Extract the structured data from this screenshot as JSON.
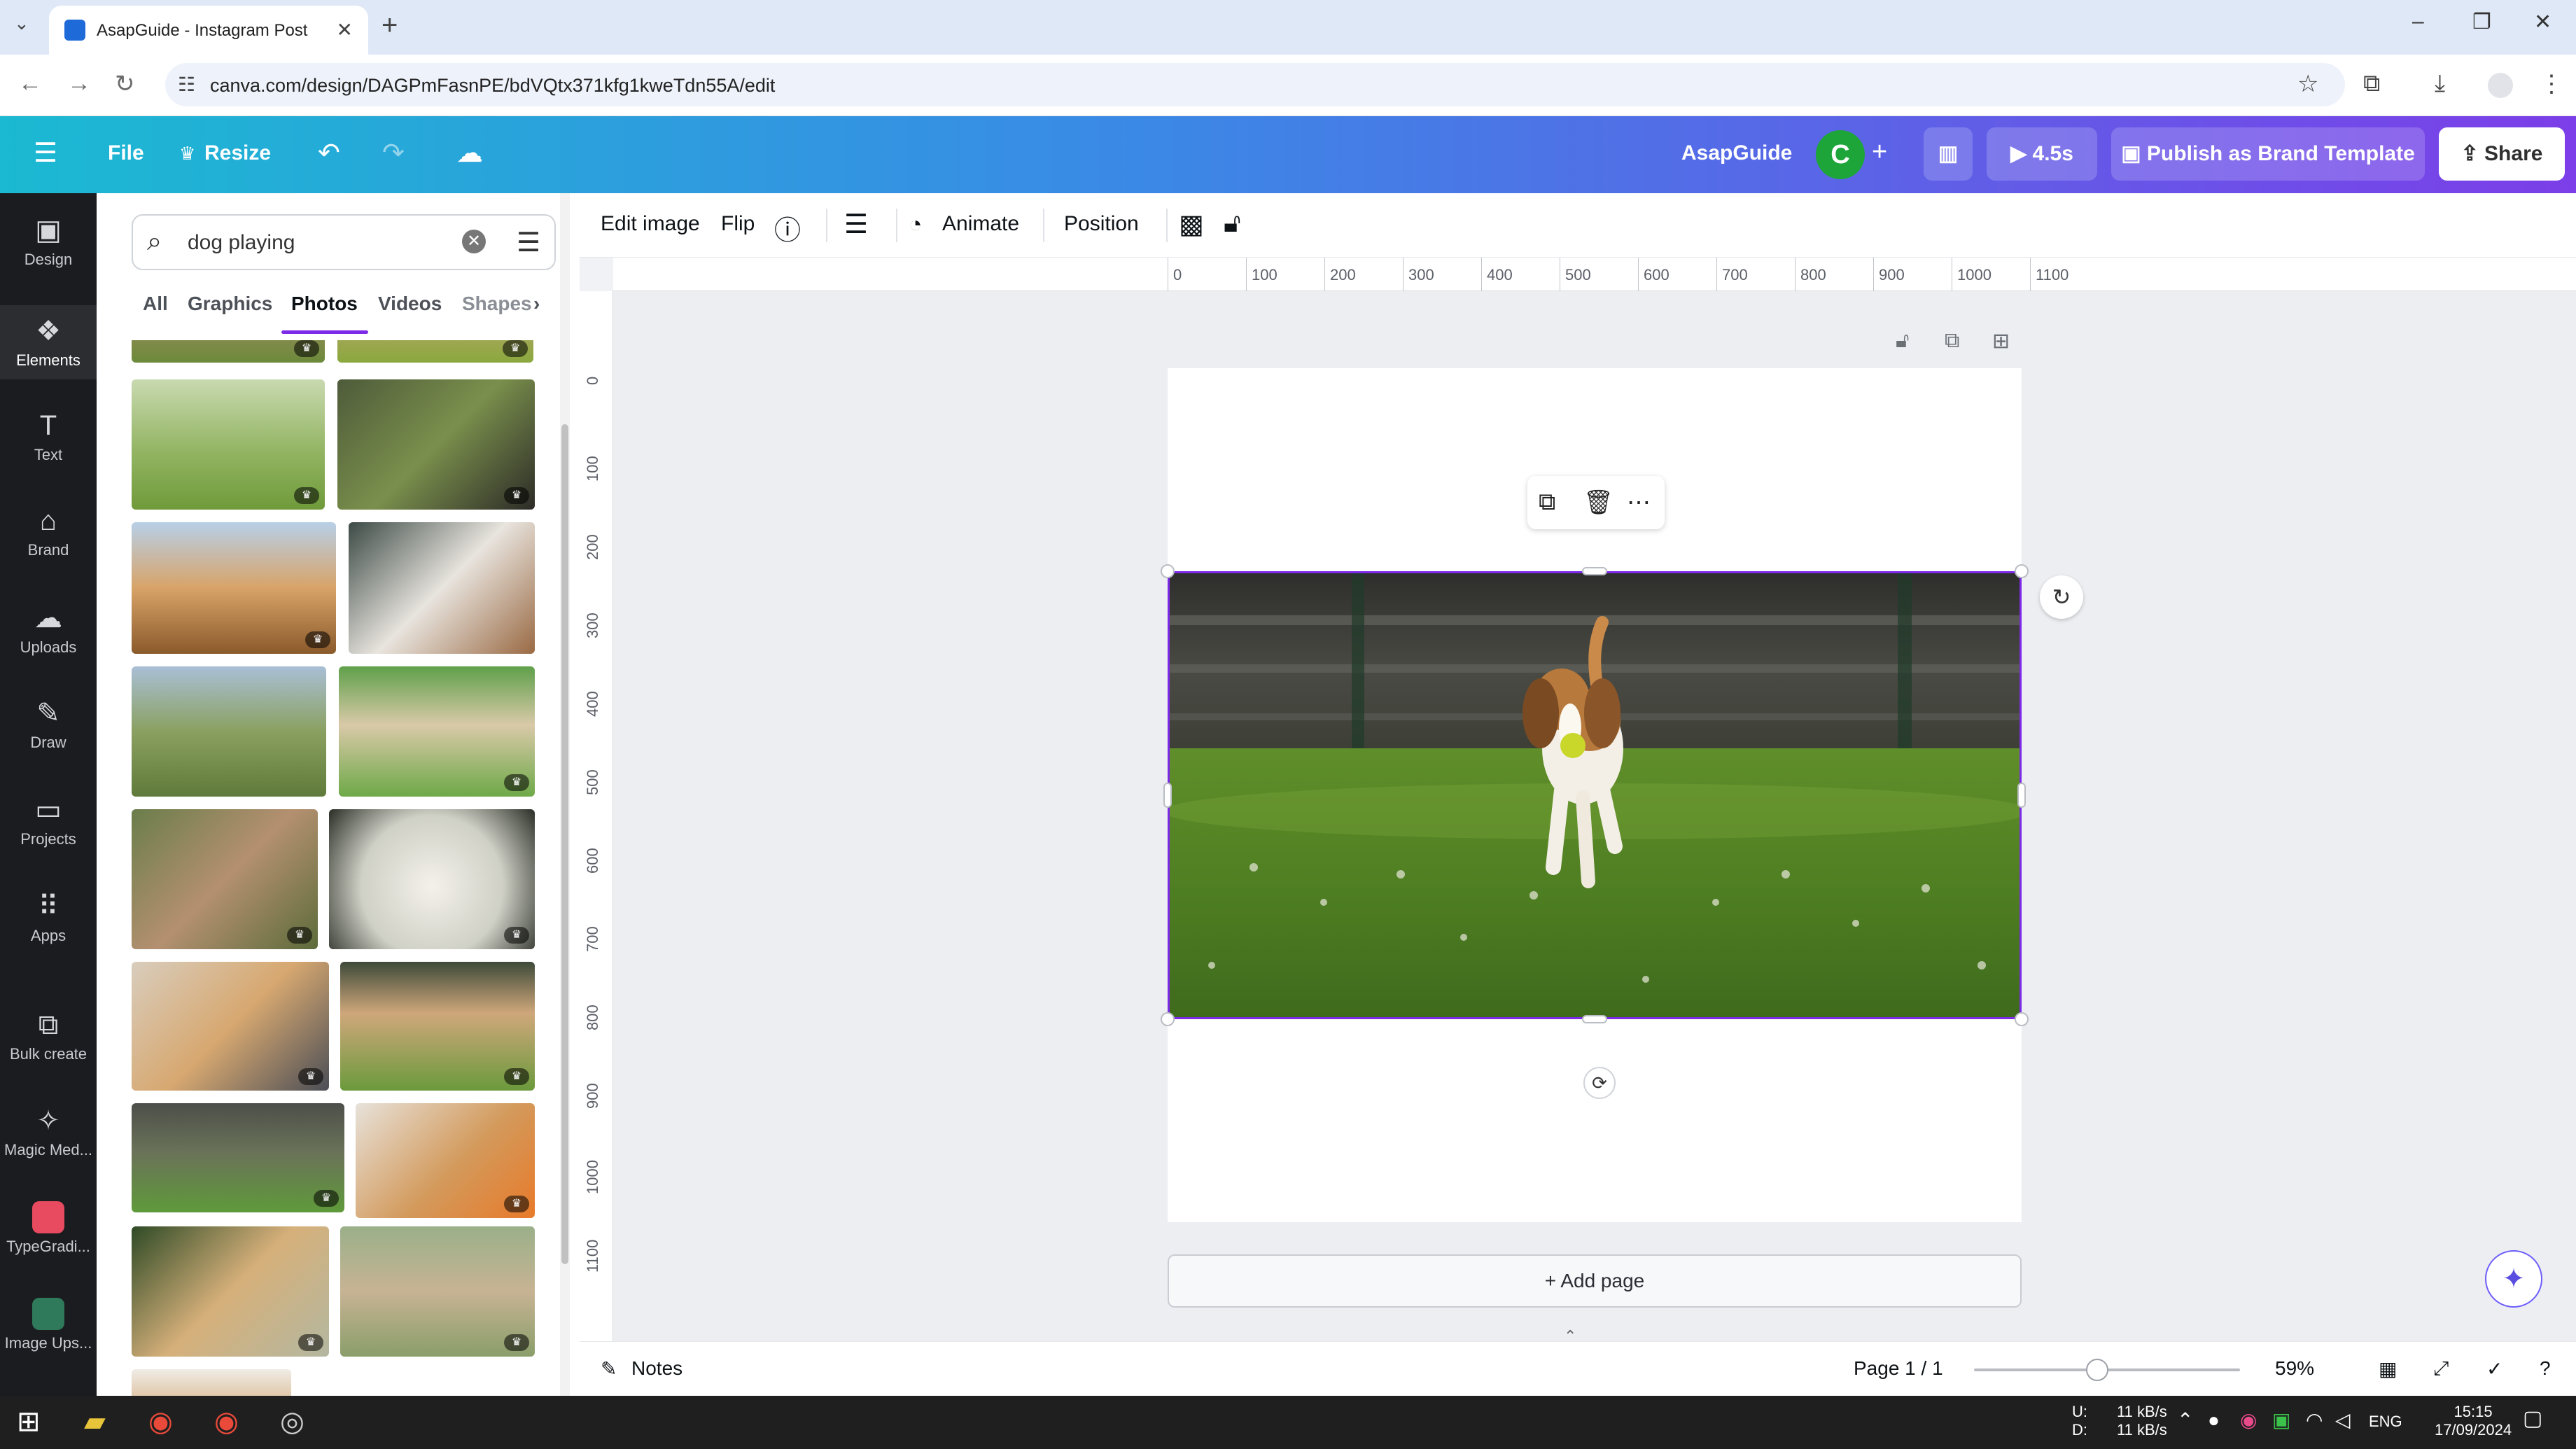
{
  "browser": {
    "tab_title": "AsapGuide - Instagram Post",
    "url": "canva.com/design/DAGPmFasnPE/bdVQtx371kfg1kweTdn55A/edit",
    "icons": [
      "tab-list-icon",
      "tab-favicon",
      "tab-close-icon",
      "new-tab-icon",
      "minimize-icon",
      "restore-icon",
      "close-window-icon",
      "back-icon",
      "forward-icon",
      "reload-icon",
      "site-info-icon",
      "bookmark-star-icon",
      "extensions-icon",
      "download-icon",
      "profile-icon",
      "browser-menu-icon"
    ]
  },
  "header": {
    "menu_icon": "hamburger-icon",
    "file_label": "File",
    "resize_label": "Resize",
    "team_name": "AsapGuide",
    "avatar_letter": "C",
    "play_label": "4.5s",
    "publish_label": "Publish as Brand Template",
    "share_label": "Share",
    "accent_colors": [
      "#1bb9d2",
      "#3b88e6",
      "#7c3ee8"
    ]
  },
  "rail": {
    "items": [
      {
        "label": "Design",
        "icon": "design-icon"
      },
      {
        "label": "Elements",
        "icon": "elements-icon"
      },
      {
        "label": "Text",
        "icon": "text-icon"
      },
      {
        "label": "Brand",
        "icon": "brand-icon"
      },
      {
        "label": "Uploads",
        "icon": "uploads-icon"
      },
      {
        "label": "Draw",
        "icon": "draw-icon"
      },
      {
        "label": "Projects",
        "icon": "projects-icon"
      },
      {
        "label": "Apps",
        "icon": "apps-icon"
      },
      {
        "label": "Bulk create",
        "icon": "bulk-create-icon"
      },
      {
        "label": "Magic Med...",
        "icon": "magic-media-icon"
      },
      {
        "label": "TypeGradi...",
        "icon": "typegradient-app-icon"
      },
      {
        "label": "Image Ups...",
        "icon": "image-upscaler-app-icon"
      }
    ],
    "active": "Elements"
  },
  "panel": {
    "search_value": "dog playing",
    "tabs": [
      "All",
      "Graphics",
      "Photos",
      "Videos",
      "Shapes"
    ],
    "active_tab": "Photos"
  },
  "toolbar": {
    "edit_image": "Edit image",
    "flip": "Flip",
    "animate": "Animate",
    "position": "Position"
  },
  "ruler": {
    "h_labels": [
      "0",
      "100",
      "200",
      "300",
      "400",
      "500",
      "600",
      "700",
      "800",
      "900",
      "1000",
      "1100"
    ],
    "v_labels": [
      "0",
      "100",
      "200",
      "300",
      "400",
      "500",
      "600",
      "700",
      "800",
      "900",
      "1000",
      "1100"
    ]
  },
  "canvas": {
    "add_page_label": "+ Add page"
  },
  "footer": {
    "notes_label": "Notes",
    "page_label": "Page 1 / 1",
    "zoom_label": "59%",
    "zoom_value": 0.59
  },
  "taskbar": {
    "net_up": "11 kB/s",
    "net_down": "11 kB/s",
    "net_up_label": "U:",
    "net_down_label": "D:",
    "lang": "ENG",
    "time": "15:15",
    "date": "17/09/2024"
  }
}
